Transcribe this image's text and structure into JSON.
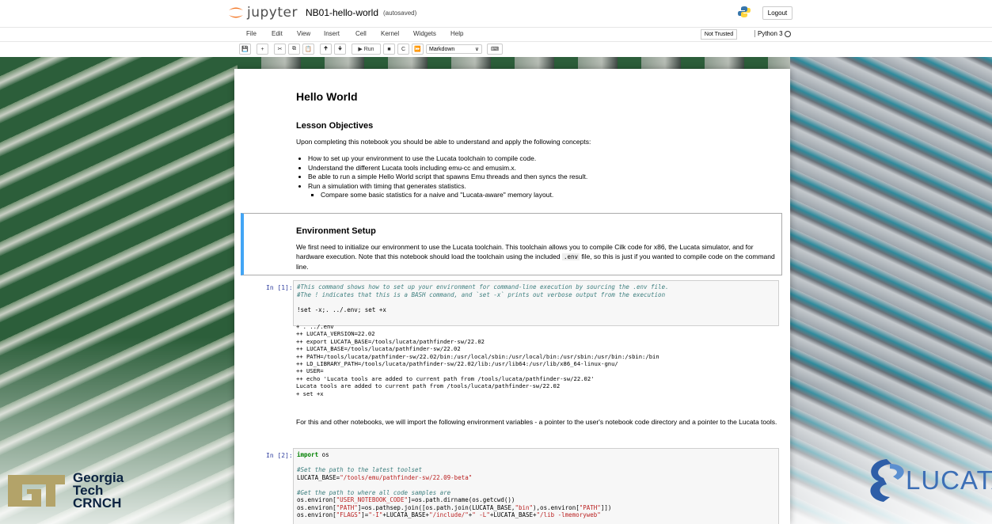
{
  "header": {
    "brand": "jupyter",
    "notebook_name": "NB01-hello-world",
    "save_status": "(autosaved)",
    "logout_label": "Logout"
  },
  "menubar": {
    "items": [
      "File",
      "Edit",
      "View",
      "Insert",
      "Cell",
      "Kernel",
      "Widgets",
      "Help"
    ],
    "trust_label": "Not Trusted",
    "kernel_name": "Python 3"
  },
  "toolbar": {
    "run_label": "Run",
    "cell_type": "Markdown"
  },
  "background": {
    "left_logo": [
      "Georgia",
      "Tech",
      "CRNCH"
    ],
    "right_logo": "LUCATA"
  },
  "notebook": {
    "title": "Hello World",
    "objectives_heading": "Lesson Objectives",
    "objectives_intro": "Upon completing this notebook you should be able to understand and apply the following concepts:",
    "objectives": [
      "How to set up your environment to use the Lucata toolchain to compile code.",
      "Understand the different Lucata tools including emu-cc and emusim.x.",
      "Be able to run a simple Hello World script that spawns Emu threads and then syncs the result.",
      "Run a simulation with timing that generates statistics."
    ],
    "sub_objective": "Compare some basic statistics for a naive and \"Lucata-aware\" memory layout.",
    "env_heading": "Environment Setup",
    "env_text_1": "We first need to initialize our environment to use the Lucata toolchain. This toolchain allows you to compile Cilk code for x86, the Lucata simulator, and for hardware execution. Note that this notebook should load the toolchain using the included",
    "env_code": ".env",
    "env_text_2": "file, so this is just if you wanted to compile code on the command line.",
    "cell1_prompt": "In [1]:",
    "cell1_comment1": "#This command shows how to set up your environment for command-line execution by sourcing the .env file.",
    "cell1_comment2": "#The ! indicates that this is a BASH command, and `set -x` prints out verbose output from the execution",
    "cell1_cmd": "!set -x;. ../.env; set +x",
    "cell1_output": [
      "+ . ../.env",
      "++ LUCATA_VERSION=22.02",
      "++ export LUCATA_BASE=/tools/lucata/pathfinder-sw/22.02",
      "++ LUCATA_BASE=/tools/lucata/pathfinder-sw/22.02",
      "++ PATH=/tools/lucata/pathfinder-sw/22.02/bin:/usr/local/sbin:/usr/local/bin:/usr/sbin:/usr/bin:/sbin:/bin",
      "++ LD_LIBRARY_PATH=/tools/lucata/pathfinder-sw/22.02/lib:/usr/lib64:/usr/lib/x86_64-linux-gnu/",
      "++ USER=",
      "++ echo 'Lucata tools are added to current path from /tools/lucata/pathfinder-sw/22.02'",
      "Lucata tools are added to current path from /tools/lucata/pathfinder-sw/22.02",
      "+ set +x"
    ],
    "import_text": "For this and other notebooks, we will import the following environment variables - a pointer to the user's notebook code directory and a pointer to the Lucata tools.",
    "cell2_prompt": "In [2]:",
    "cell2_lines": {
      "import_kw": "import",
      "import_mod": " os",
      "c1": "#Set the path to the latest toolset",
      "l1a": "LUCATA_BASE=",
      "l1b": "\"/tools/emu/pathfinder-sw/22.09-beta\"",
      "c2": "#Get the path to where all code samples are",
      "l2a": "os.environ[",
      "l2b": "\"USER_NOTEBOOK_CODE\"",
      "l2c": "]=os.path.dirname(os.getcwd())",
      "l3a": "os.environ[",
      "l3b": "\"PATH\"",
      "l3c": "]=os.pathsep.join([os.path.join(LUCATA_BASE,",
      "l3d": "\"bin\"",
      "l3e": "),os.environ[",
      "l3f": "\"PATH\"",
      "l3g": "]])",
      "l4a": "os.environ[",
      "l4b": "\"FLAGS\"",
      "l4c": "]=",
      "l4d": "\"-I\"",
      "l4e": "+LUCATA_BASE+",
      "l4f": "\"/include/\"",
      "l4g": "+",
      "l4h": "\" -L\"",
      "l4i": "+LUCATA_BASE+",
      "l4j": "\"/lib -lmemoryweb\""
    }
  }
}
